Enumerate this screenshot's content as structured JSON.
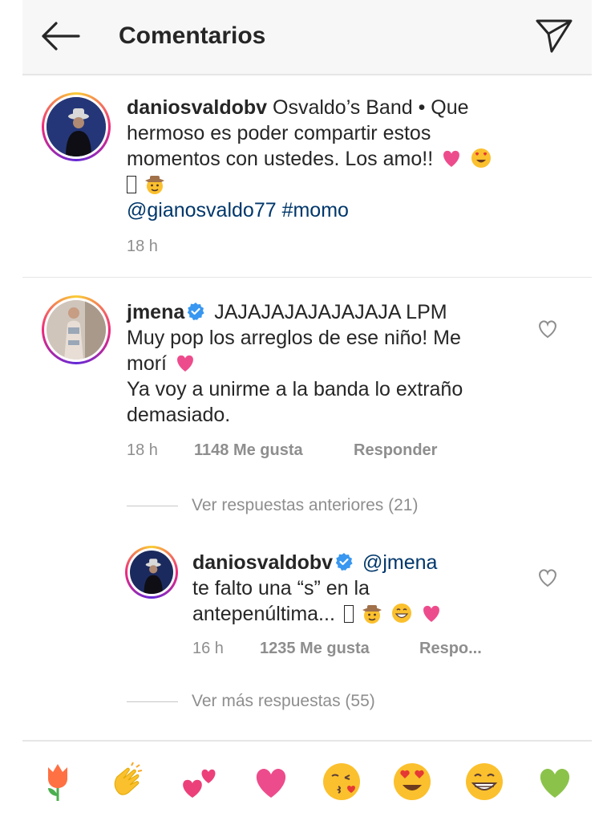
{
  "header": {
    "title": "Comentarios",
    "back_icon": "arrow-left-icon",
    "share_icon": "paper-plane-icon"
  },
  "caption": {
    "username": "daniosvaldobv",
    "text_line1": " Osvaldo’s Band • Que",
    "text_line2": "hermoso es poder compartir estos",
    "text_line3": "momentos con ustedes. Los amo!!",
    "mention": "@gianosvaldo77",
    "hashtag": "#momo",
    "time": "18 h"
  },
  "comment": {
    "username": "jmena",
    "text_line1": " JAJAJAJAJAJAJAJA LPM",
    "text_line2": "Muy pop los arreglos de ese niño! Me",
    "text_line3": "morí",
    "text_line4": "Ya voy a unirme a la banda lo extraño",
    "text_line5": "demasiado.",
    "time": "18 h",
    "likes": "1148 Me gusta",
    "reply_label": "Responder",
    "view_previous": "Ver respuestas anteriores (21)"
  },
  "reply": {
    "username": "daniosvaldobv",
    "mention": " @jmena",
    "text_line1": "te falto una “s” en la",
    "text_line2": "antepenúltima...",
    "time": "16 h",
    "likes": "1235 Me gusta",
    "reply_label": "Respo...",
    "view_more": "Ver más respuestas (55)"
  },
  "colors": {
    "accent_link": "#00376b",
    "verified": "#3897f0",
    "heart": "#ed4c8c",
    "meta": "#8e8e8e"
  },
  "emoji_bar": [
    "tulip",
    "clapping-hands",
    "two-hearts",
    "heart",
    "kissing-face",
    "heart-eyes-face",
    "grinning-face",
    "green-heart"
  ]
}
